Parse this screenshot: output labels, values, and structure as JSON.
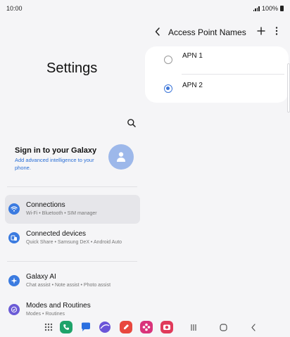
{
  "status_bar": {
    "time": "10:00",
    "battery": "100%"
  },
  "settings": {
    "title": "Settings",
    "account": {
      "title": "Sign in to your Galaxy",
      "subtitle": "Add advanced intelligence to your phone."
    },
    "items": [
      {
        "label": "Connections",
        "sub": "Wi-Fi • Bluetooth • SIM manager",
        "icon": "wifi-icon",
        "color": "#3b7be0"
      },
      {
        "label": "Connected devices",
        "sub": "Quick Share • Samsung DeX • Android Auto",
        "icon": "devices-icon",
        "color": "#3b7be0"
      },
      {
        "label": "Galaxy AI",
        "sub": "Chat assist • Note assist • Photo assist",
        "icon": "sparkle-icon",
        "color": "#3b7be0"
      },
      {
        "label": "Modes and Routines",
        "sub": "Modes • Routines",
        "icon": "check-circle-icon",
        "color": "#6b5bd6"
      }
    ]
  },
  "apn": {
    "title": "Access Point Names",
    "items": [
      {
        "label": "APN 1",
        "selected": false
      },
      {
        "label": "APN 2",
        "selected": true
      }
    ]
  },
  "taskbar": {
    "apps": [
      "apps-grid-icon",
      "phone-app-icon",
      "messages-app-icon",
      "internet-app-icon",
      "notes-app-icon",
      "flower-app-icon",
      "camera-app-icon"
    ],
    "app_colors": [
      "#555555",
      "#1fa36a",
      "#2a6fe0",
      "#6b55d8",
      "#e8473e",
      "#d9337a",
      "#e03a5a"
    ],
    "nav": [
      "recents-icon",
      "home-icon",
      "back-icon"
    ]
  }
}
